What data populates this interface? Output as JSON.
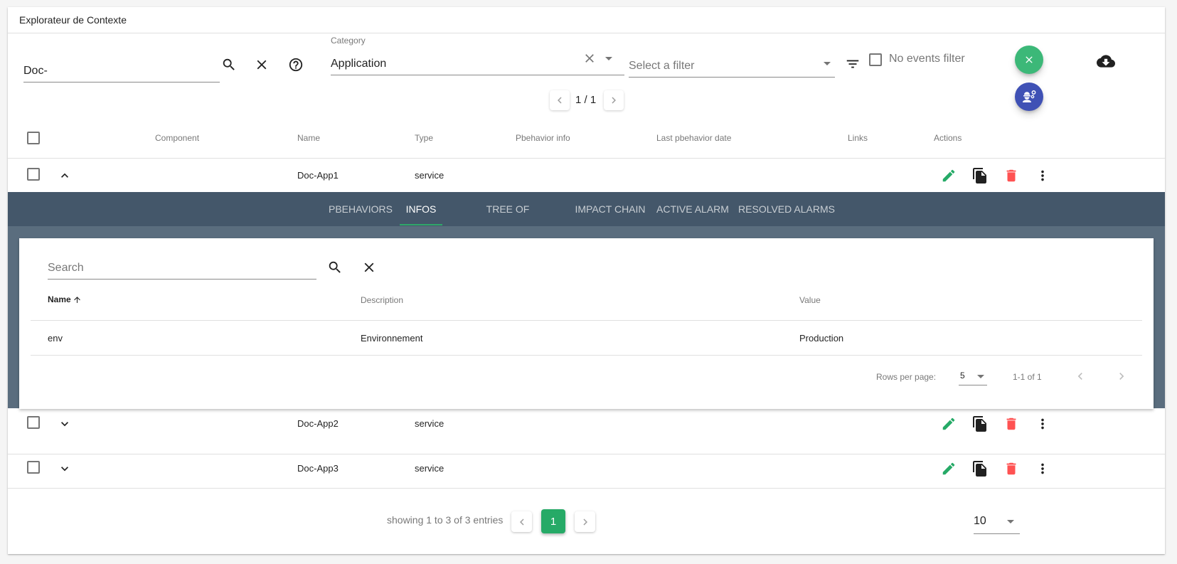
{
  "window": {
    "title": "Explorateur de Contexte"
  },
  "toolbar": {
    "search_value": "Doc-",
    "category_label": "Category",
    "category_value": "Application",
    "filter_placeholder": "Select a filter",
    "no_events_label": "No events filter",
    "mini_pagination": "1 / 1"
  },
  "colors": {
    "accent": "#26aa67",
    "fab_green": "#3cb878",
    "fab_blue": "#3f51b5",
    "tabs_bg": "#44576a",
    "expand_bg": "#5a6d7e",
    "delete": "#ff5252"
  },
  "table": {
    "headers": [
      "Component",
      "Name",
      "Type",
      "Pbehavior info",
      "Last pbehavior date",
      "Links",
      "Actions"
    ],
    "rows": [
      {
        "component": "",
        "name": "Doc-App1",
        "type": "service",
        "expanded": true
      },
      {
        "component": "",
        "name": "Doc-App2",
        "type": "service",
        "expanded": false
      },
      {
        "component": "",
        "name": "Doc-App3",
        "type": "service",
        "expanded": false
      }
    ]
  },
  "expanded": {
    "tabs": [
      "Pbehaviors",
      "Infos",
      "Tree of dependencies",
      "Impact chain",
      "Active alarm",
      "Resolved alarms"
    ],
    "active_tab": "Infos",
    "infos": {
      "search_placeholder": "Search",
      "headers": [
        "Name",
        "Description",
        "Value"
      ],
      "sort_column": "Name",
      "rows": [
        {
          "name": "env",
          "description": "Environnement",
          "value": "Production"
        }
      ],
      "rows_per_page_label": "Rows per page:",
      "rows_per_page": "5",
      "range": "1-1 of 1"
    }
  },
  "footer": {
    "showing": "showing 1 to 3 of 3 entries",
    "current_page": "1",
    "per_page": "10"
  }
}
